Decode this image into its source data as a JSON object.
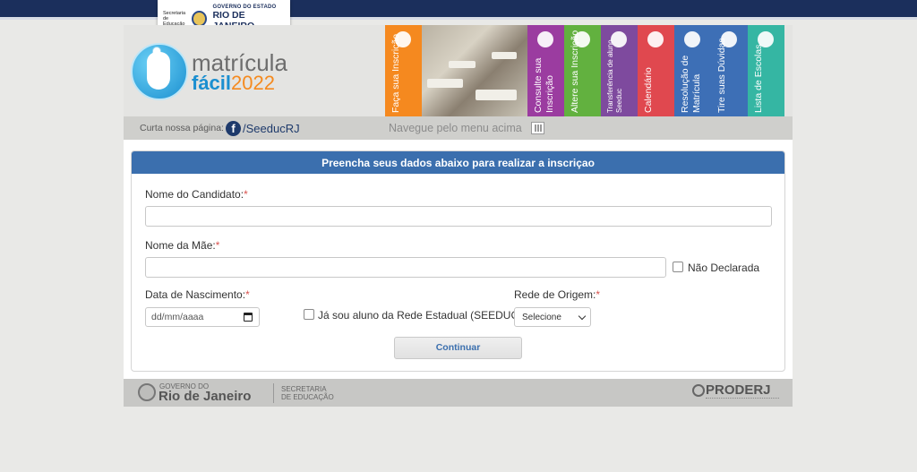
{
  "top": {
    "secretaria_label": "Secretaria de Educação",
    "gov_small": "GOVERNO DO ESTADO",
    "gov_big": "RIO DE JANEIRO"
  },
  "brand": {
    "line1": "matrícula",
    "line2": "fácil",
    "year": "2022"
  },
  "menu": [
    {
      "label": "Faça sua Inscrição",
      "color": "#f5891f",
      "icon": "add-user-icon"
    },
    {
      "label": "Consulte sua Inscrição",
      "color": "#9b3ca0",
      "icon": "search-list-icon"
    },
    {
      "label": "Altere sua Inscrição",
      "color": "#62b13f",
      "icon": "id-card-icon"
    },
    {
      "label": "Transferência de aluno Seeduc",
      "color": "#7e4a9e",
      "icon": "transfer-icon"
    },
    {
      "label": "Calendário",
      "color": "#e0484f",
      "icon": "calendar-icon"
    },
    {
      "label": "Resolução de Matrícula",
      "color": "#3d6fb6",
      "icon": "document-icon"
    },
    {
      "label": "Tire suas Dúvidas",
      "color": "#3d6fb6",
      "icon": "chat-icon"
    },
    {
      "label": "Lista de Escolas",
      "color": "#35b6a3",
      "icon": "list-icon"
    }
  ],
  "subbar": {
    "curta": "Curta nossa página:",
    "facebook_link": "/SeeducRJ",
    "navegue": "Navegue pelo menu acima"
  },
  "form": {
    "header": "Preencha seus dados abaixo para realizar a inscriçao",
    "nome_candidato_label": "Nome do Candidato:",
    "nome_mae_label": "Nome da Mãe:",
    "nao_declarada_label": "Não Declarada",
    "data_nascimento_label": "Data de Nascimento:",
    "date_placeholder": "dd/mm/aaaa",
    "ja_sou_aluno_label": "Já sou aluno da Rede Estadual (SEEDUC)",
    "rede_origem_label": "Rede de Origem:",
    "rede_origem_selected": "Selecione",
    "continuar_label": "Continuar",
    "required_mark": "*"
  },
  "footer": {
    "gov_small": "GOVERNO DO",
    "gov_big": "Rio de Janeiro",
    "secretaria": "SECRETARIA",
    "educacao": "DE EDUCAÇÃO",
    "proderj": "PRODERJ"
  }
}
